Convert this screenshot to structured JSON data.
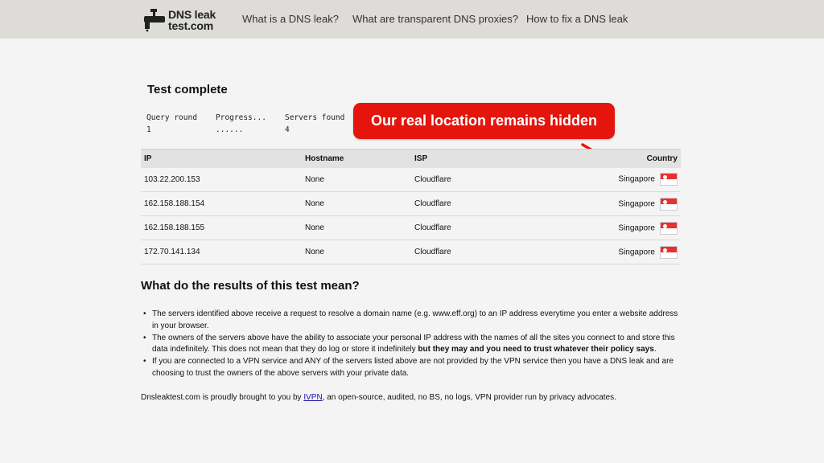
{
  "header": {
    "logo": {
      "line1": "DNS leak",
      "line2": "test.com"
    },
    "nav": [
      "What is a DNS leak?",
      "What are transparent DNS proxies?",
      "How to fix a DNS leak"
    ]
  },
  "status": {
    "title": "Test complete",
    "cols": [
      {
        "label": "Query round",
        "value": "1"
      },
      {
        "label": "Progress...",
        "value": "......"
      },
      {
        "label": "Servers found",
        "value": "4"
      }
    ]
  },
  "callout": "Our real location remains hidden",
  "table": {
    "headers": [
      "IP",
      "Hostname",
      "ISP",
      "Country"
    ],
    "rows": [
      {
        "ip": "103.22.200.153",
        "hostname": "None",
        "isp": "Cloudflare",
        "country": "Singapore"
      },
      {
        "ip": "162.158.188.154",
        "hostname": "None",
        "isp": "Cloudflare",
        "country": "Singapore"
      },
      {
        "ip": "162.158.188.155",
        "hostname": "None",
        "isp": "Cloudflare",
        "country": "Singapore"
      },
      {
        "ip": "172.70.141.134",
        "hostname": "None",
        "isp": "Cloudflare",
        "country": "Singapore"
      }
    ]
  },
  "explanation": {
    "heading": "What do the results of this test mean?",
    "bullets": [
      {
        "text": "The servers identified above receive a request to resolve a domain name (e.g. www.eff.org) to an IP address everytime you enter a website address in your browser.",
        "bold": "",
        "after": ""
      },
      {
        "text": "The owners of the servers above have the ability to associate your personal IP address with the names of all the sites you connect to and store this data indefinitely. This does not mean that they do log or store it indefinitely ",
        "bold": "but they may and you need to trust whatever their policy says",
        "after": "."
      },
      {
        "text": "If you are connected to a VPN service and ANY of the servers listed above are not provided by the VPN service then you have a DNS leak and are choosing to trust the owners of the above servers with your private data.",
        "bold": "",
        "after": ""
      }
    ]
  },
  "footer": {
    "before": "Dnsleaktest.com is proudly brought to you by ",
    "link": "IVPN",
    "after": ", an open-source, audited, no BS, no logs, VPN provider run by privacy advocates."
  },
  "colors": {
    "callout": "#e5150e",
    "header": "#dddcd8",
    "link": "#1a0dab"
  },
  "icons": {
    "logo": "faucet-icon",
    "flag": "singapore-flag-icon"
  }
}
